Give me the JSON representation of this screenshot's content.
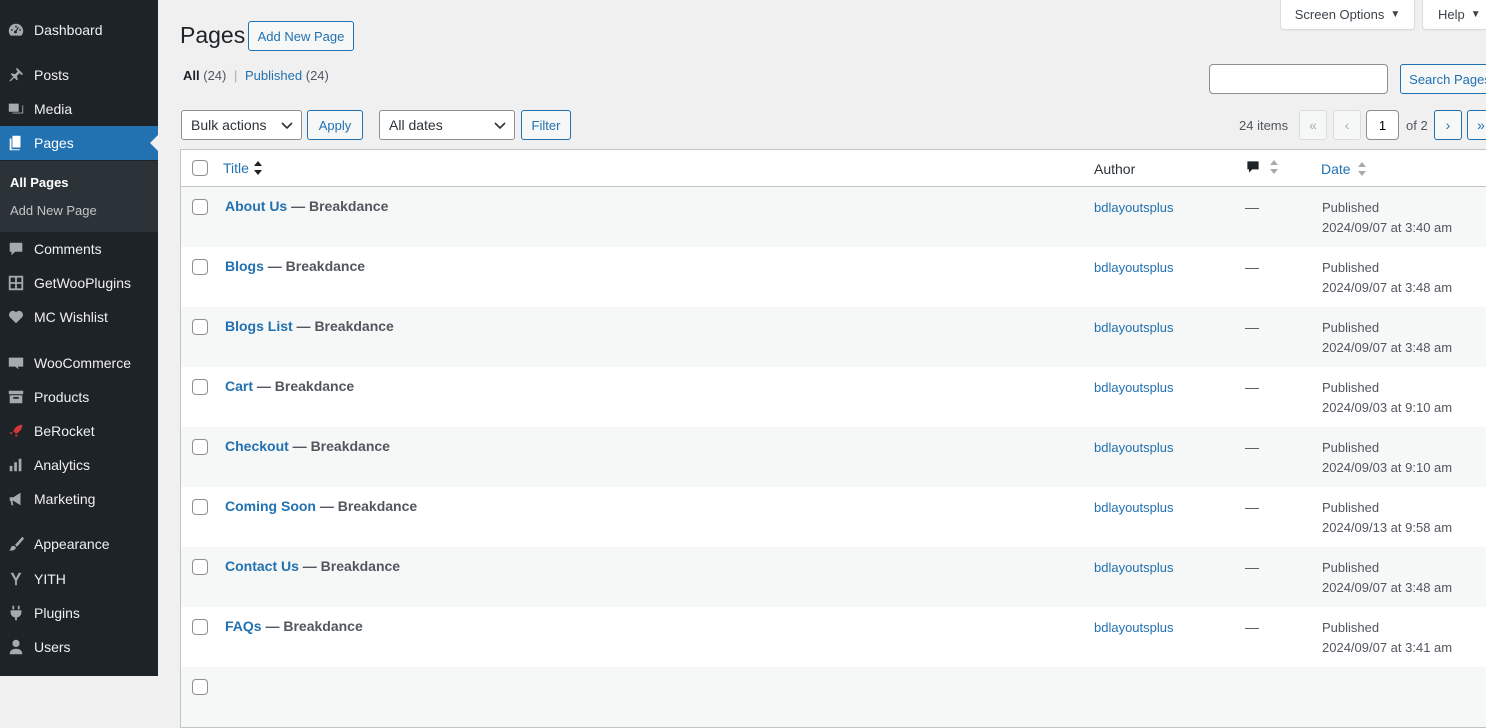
{
  "sidebar": {
    "items": [
      {
        "label": "Dashboard",
        "icon": "dashboard-icon"
      },
      {
        "label": "Posts",
        "icon": "pin-icon"
      },
      {
        "label": "Media",
        "icon": "media-icon"
      },
      {
        "label": "Pages",
        "icon": "pages-icon"
      },
      {
        "label": "Comments",
        "icon": "comment-icon"
      },
      {
        "label": "GetWooPlugins",
        "icon": "plugin-grid-icon"
      },
      {
        "label": "MC Wishlist",
        "icon": "heart-icon"
      },
      {
        "label": "WooCommerce",
        "icon": "woo-icon"
      },
      {
        "label": "Products",
        "icon": "archive-icon"
      },
      {
        "label": "BeRocket",
        "icon": "rocket-icon"
      },
      {
        "label": "Analytics",
        "icon": "bar-chart-icon"
      },
      {
        "label": "Marketing",
        "icon": "megaphone-icon"
      },
      {
        "label": "Appearance",
        "icon": "brush-icon"
      },
      {
        "label": "YITH",
        "icon": "yith-icon"
      },
      {
        "label": "Plugins",
        "icon": "plug-icon"
      },
      {
        "label": "Users",
        "icon": "user-icon"
      }
    ],
    "submenu": {
      "all_pages": "All Pages",
      "add_new_page": "Add New Page"
    }
  },
  "header": {
    "title": "Pages",
    "add_new": "Add New Page",
    "screen_options": "Screen Options",
    "help": "Help"
  },
  "views": {
    "all": "All",
    "all_count": "(24)",
    "sep": "|",
    "published": "Published",
    "published_count": "(24)"
  },
  "search": {
    "button": "Search Pages",
    "placeholder": ""
  },
  "toolbar": {
    "bulk_actions": "Bulk actions",
    "apply": "Apply",
    "all_dates": "All dates",
    "filter": "Filter"
  },
  "pagination": {
    "items": "24 items",
    "first": "«",
    "prev": "‹",
    "current_page": "1",
    "of": "of 2",
    "next": "›",
    "last": "»"
  },
  "table": {
    "headers": {
      "title": "Title",
      "author": "Author",
      "date": "Date"
    },
    "rows": [
      {
        "title": "About Us",
        "suffix": " — Breakdance",
        "author": "bdlayoutsplus",
        "comments": "—",
        "status": "Published",
        "date": "2024/09/07 at 3:40 am"
      },
      {
        "title": "Blogs",
        "suffix": " — Breakdance",
        "author": "bdlayoutsplus",
        "comments": "—",
        "status": "Published",
        "date": "2024/09/07 at 3:48 am"
      },
      {
        "title": "Blogs List",
        "suffix": " — Breakdance",
        "author": "bdlayoutsplus",
        "comments": "—",
        "status": "Published",
        "date": "2024/09/07 at 3:48 am"
      },
      {
        "title": "Cart",
        "suffix": " — Breakdance",
        "author": "bdlayoutsplus",
        "comments": "—",
        "status": "Published",
        "date": "2024/09/03 at 9:10 am"
      },
      {
        "title": "Checkout",
        "suffix": " — Breakdance",
        "author": "bdlayoutsplus",
        "comments": "—",
        "status": "Published",
        "date": "2024/09/03 at 9:10 am"
      },
      {
        "title": "Coming Soon",
        "suffix": " — Breakdance",
        "author": "bdlayoutsplus",
        "comments": "—",
        "status": "Published",
        "date": "2024/09/13 at 9:58 am"
      },
      {
        "title": "Contact Us",
        "suffix": " — Breakdance",
        "author": "bdlayoutsplus",
        "comments": "—",
        "status": "Published",
        "date": "2024/09/07 at 3:48 am"
      },
      {
        "title": "FAQs",
        "suffix": " — Breakdance",
        "author": "bdlayoutsplus",
        "comments": "—",
        "status": "Published",
        "date": "2024/09/07 at 3:41 am"
      }
    ]
  },
  "colors": {
    "sidebar": "#1d2327",
    "accent": "#2271b1",
    "submenu": "#2c3338"
  }
}
